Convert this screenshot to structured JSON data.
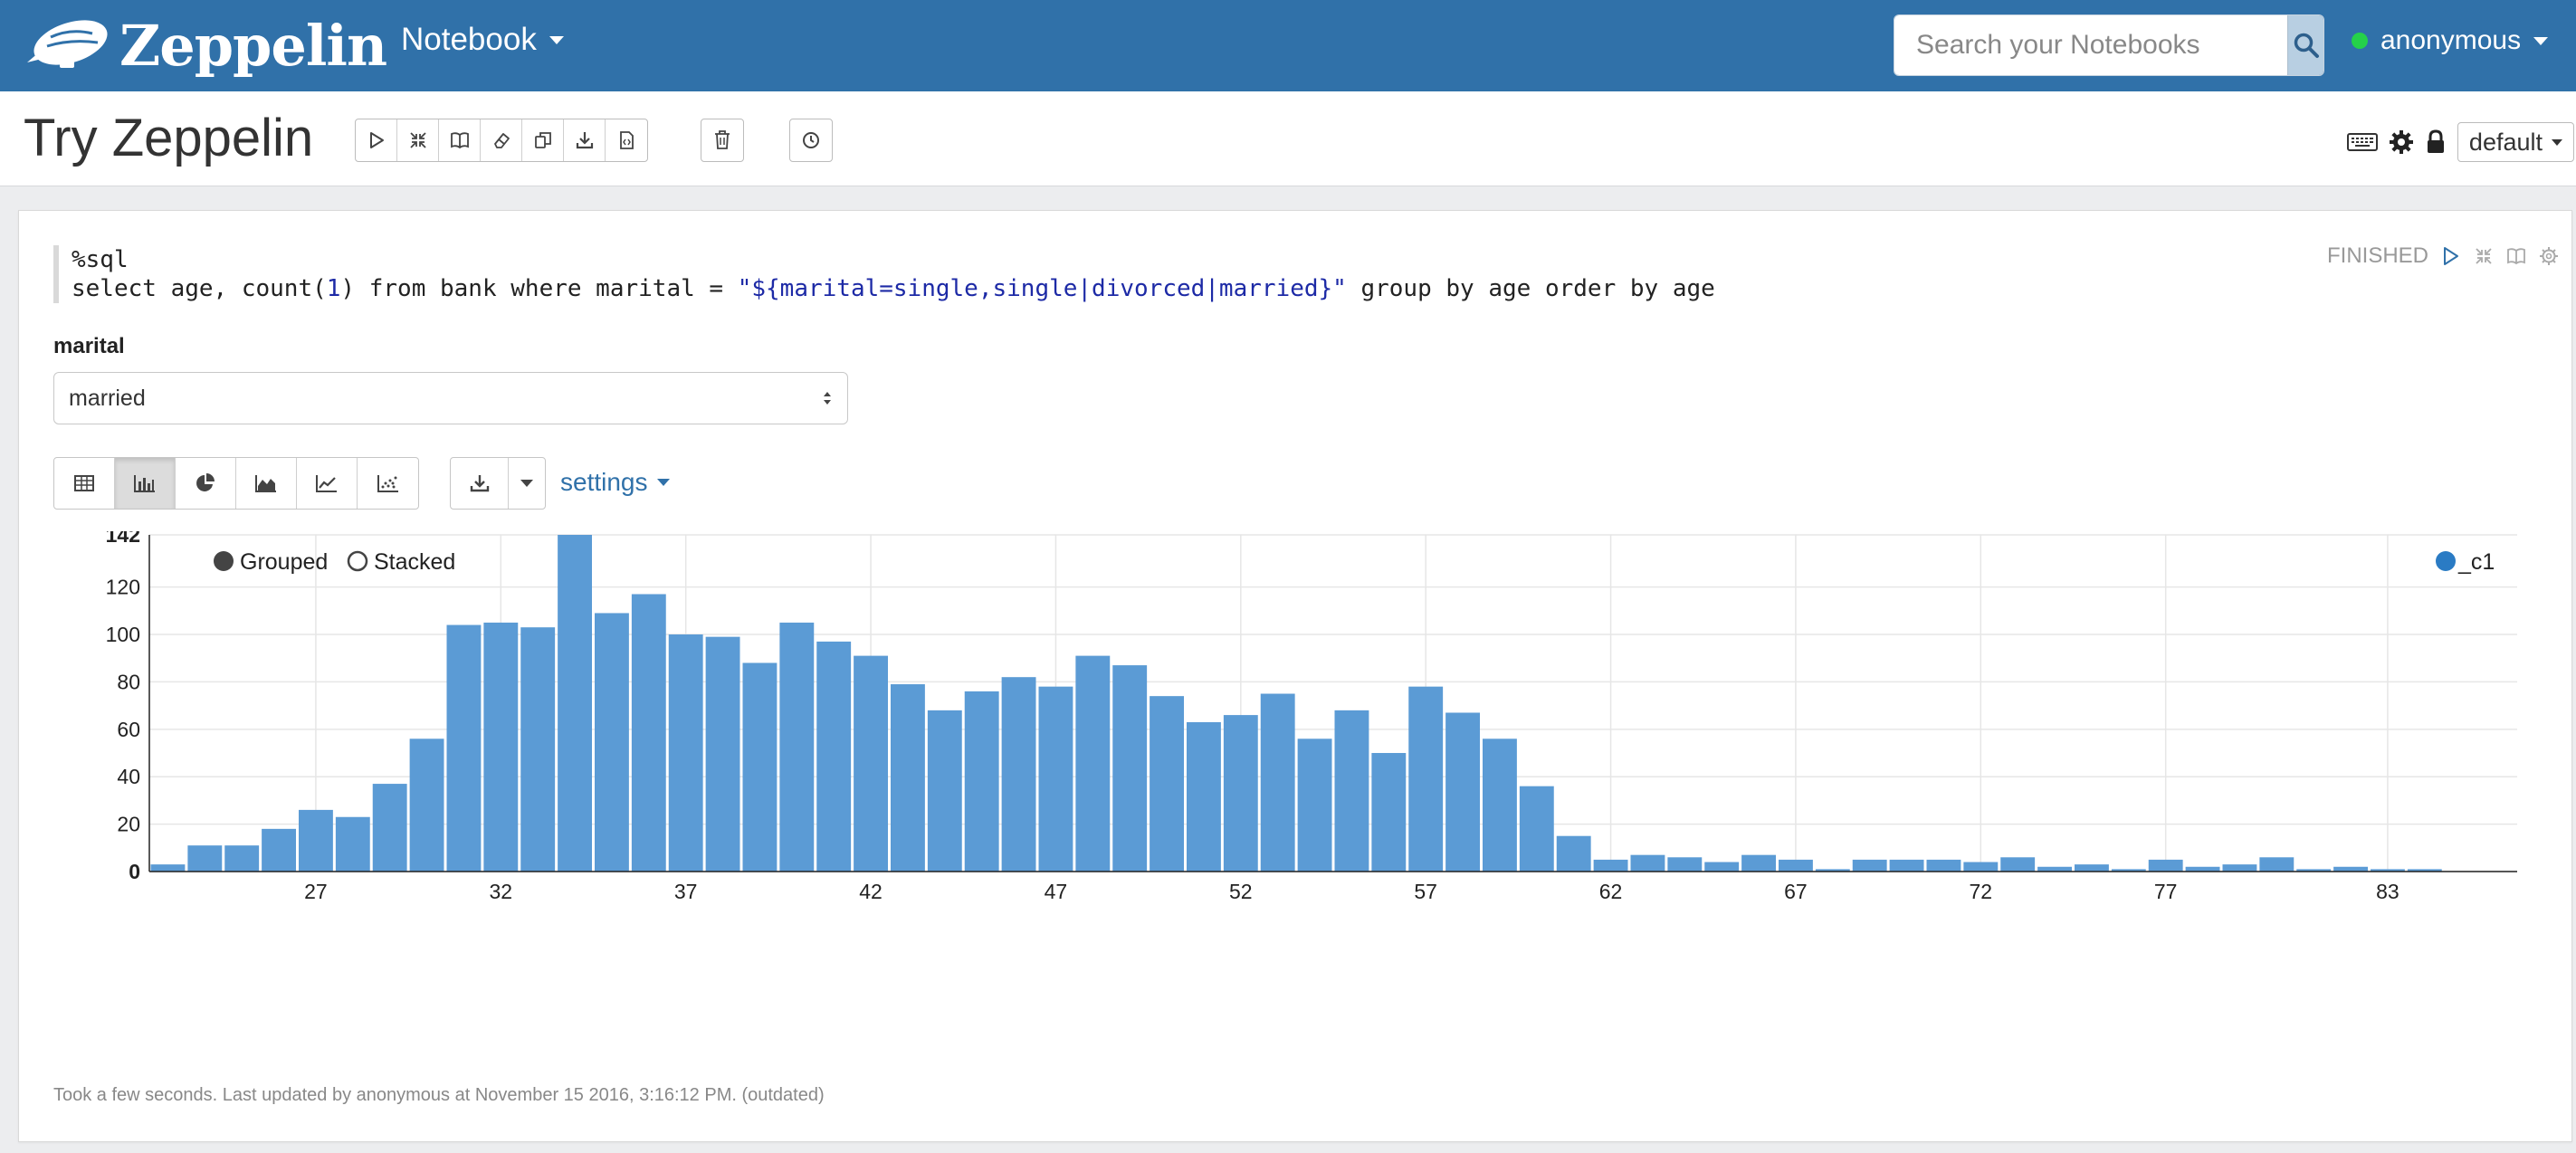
{
  "navbar": {
    "brand": "Zeppelin",
    "notebook_menu": "Notebook",
    "search_placeholder": "Search your Notebooks",
    "user": "anonymous"
  },
  "notebook": {
    "title": "Try Zeppelin",
    "interpreter_binding": "default"
  },
  "paragraph": {
    "status": "FINISHED",
    "code_line1": "%sql",
    "code_select": "select age, count(",
    "code_num": "1",
    "code_mid": ") from bank where marital = ",
    "code_string": "\"${marital=single,single|divorced|married}\"",
    "code_tail": " group by age order by age",
    "form_label": "marital",
    "form_value": "married",
    "settings_label": "settings",
    "footer": "Took a few seconds. Last updated by anonymous at November 15 2016, 3:16:12 PM. (outdated)"
  },
  "chart_data": {
    "type": "bar",
    "mode_options": [
      "Grouped",
      "Stacked"
    ],
    "mode_selected": "Grouped",
    "legend": [
      "_c1"
    ],
    "legend_position": "top-right",
    "series_color": "#5b9bd5",
    "x": [
      23,
      24,
      25,
      26,
      27,
      28,
      29,
      30,
      31,
      32,
      33,
      34,
      35,
      36,
      37,
      38,
      39,
      40,
      41,
      42,
      43,
      44,
      45,
      46,
      47,
      48,
      49,
      50,
      51,
      52,
      53,
      54,
      55,
      56,
      57,
      58,
      59,
      60,
      61,
      62,
      63,
      64,
      65,
      66,
      67,
      68,
      69,
      70,
      71,
      72,
      73,
      74,
      75,
      76,
      77,
      78,
      79,
      80,
      81,
      82,
      83,
      84,
      85,
      86
    ],
    "series": [
      {
        "name": "_c1",
        "values": [
          3,
          11,
          11,
          18,
          26,
          23,
          37,
          56,
          104,
          105,
          103,
          142,
          109,
          117,
          100,
          99,
          88,
          105,
          97,
          91,
          79,
          68,
          76,
          82,
          78,
          91,
          87,
          74,
          63,
          66,
          75,
          56,
          68,
          50,
          78,
          67,
          56,
          36,
          15,
          5,
          7,
          6,
          4,
          7,
          5,
          1,
          5,
          5,
          5,
          4,
          6,
          2,
          3,
          1,
          5,
          2,
          3,
          6,
          1,
          2,
          1,
          1,
          0,
          0
        ]
      }
    ],
    "x_tick_labels": [
      "27",
      "32",
      "37",
      "42",
      "47",
      "52",
      "57",
      "62",
      "67",
      "72",
      "77",
      "83"
    ],
    "y_tick_labels": [
      "0",
      "20",
      "40",
      "60",
      "80",
      "100",
      "120",
      "142"
    ],
    "ylim": [
      0,
      142
    ],
    "grid": true
  }
}
